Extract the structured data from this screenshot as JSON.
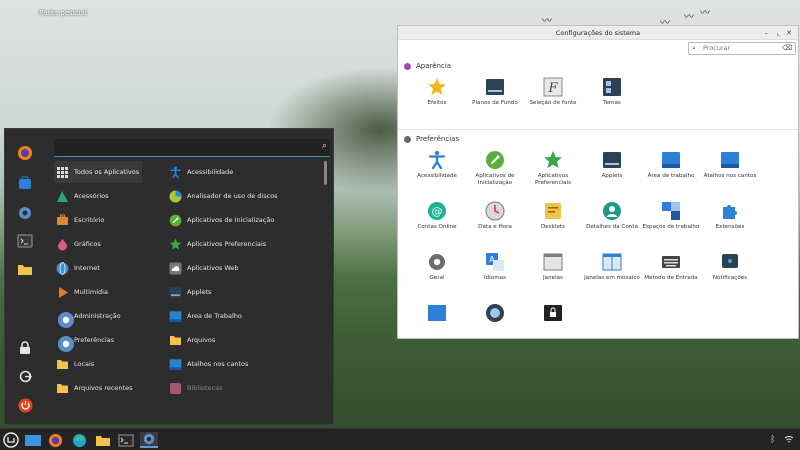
{
  "desktop": {
    "icon_label": "Pasta pessoal"
  },
  "menu": {
    "search_placeholder": "",
    "categories": [
      {
        "label": "Todos os Aplicativos",
        "icon": "grid-icon",
        "color": "#dddddd"
      },
      {
        "label": "Acessórios",
        "icon": "accessories-icon",
        "color": "#2aa876"
      },
      {
        "label": "Escritório",
        "icon": "briefcase-icon",
        "color": "#d98a3a"
      },
      {
        "label": "Gráficos",
        "icon": "graphics-icon",
        "color": "#e0578b"
      },
      {
        "label": "Internet",
        "icon": "globe-icon",
        "color": "#3b8fd9"
      },
      {
        "label": "Multimídia",
        "icon": "play-icon",
        "color": "#f0712b"
      },
      {
        "label": "Administração",
        "icon": "gear-icon",
        "color": "#5b8fc9"
      },
      {
        "label": "Preferências",
        "icon": "gear-icon",
        "color": "#5b8fc9"
      },
      {
        "label": "Locais",
        "icon": "folder-icon",
        "color": "#f2c24a"
      },
      {
        "label": "Arquivos recentes",
        "icon": "recent-folder-icon",
        "color": "#f2c24a"
      }
    ],
    "apps": [
      {
        "label": "Acessibilidade",
        "icon": "accessibility-icon",
        "color": "#2f7fd8"
      },
      {
        "label": "Analisador de uso de discos",
        "icon": "disk-usage-icon",
        "color": "#a8c93a"
      },
      {
        "label": "Aplicativos de Inicialização",
        "icon": "rocket-icon",
        "color": "#5aae3f"
      },
      {
        "label": "Aplicativos Preferenciais",
        "icon": "star-icon",
        "color": "#3aa54a"
      },
      {
        "label": "Aplicativos Web",
        "icon": "cloud-icon",
        "color": "#6c7a86"
      },
      {
        "label": "Applets",
        "icon": "applets-icon",
        "color": "#2c4152"
      },
      {
        "label": "Área de Trabalho",
        "icon": "desktop-icon",
        "color": "#2d7fd8"
      },
      {
        "label": "Arquivos",
        "icon": "folder-icon",
        "color": "#f2c24a"
      },
      {
        "label": "Atalhos nos cantos",
        "icon": "corners-icon",
        "color": "#2d7fd8"
      },
      {
        "label": "Bibliotecas",
        "icon": "library-icon",
        "color": "#a35a6a"
      }
    ]
  },
  "settings": {
    "title": "Configurações do sistema",
    "search_placeholder": "Procurar",
    "sections": [
      {
        "title": "Aparência",
        "dot_color": "#9a4ea8",
        "items": [
          {
            "label": "Efeitos",
            "icon": "star-icon",
            "color": "#f2b824"
          },
          {
            "label": "Planos de Fundo",
            "icon": "wallpaper-icon",
            "color": "#2c4152"
          },
          {
            "label": "Seleção de fonte",
            "icon": "font-icon",
            "color": "#8a8a8a"
          },
          {
            "label": "Temas",
            "icon": "themes-icon",
            "color": "#2c4152"
          }
        ]
      },
      {
        "title": "Preferências",
        "dot_color": "#666666",
        "items": [
          {
            "label": "Acessibilidade",
            "icon": "accessibility-icon",
            "color": "#2f7fd8"
          },
          {
            "label": "Aplicativos de Inicialização",
            "icon": "rocket-icon",
            "color": "#5aae3f"
          },
          {
            "label": "Aplicativos Preferenciais",
            "icon": "star-icon",
            "color": "#3aa54a"
          },
          {
            "label": "Applets",
            "icon": "applets-icon",
            "color": "#2c4152"
          },
          {
            "label": "Área de trabalho",
            "icon": "desktop-icon",
            "color": "#2d7fd8"
          },
          {
            "label": "Atalhos nos cantos",
            "icon": "corners-icon",
            "color": "#2d7fd8"
          },
          {
            "label": "Contas Online",
            "icon": "at-icon",
            "color": "#1ab394"
          },
          {
            "label": "Data e Hora",
            "icon": "clock-icon",
            "color": "#d9d9d9"
          },
          {
            "label": "Desklets",
            "icon": "desklets-icon",
            "color": "#f2c24a"
          },
          {
            "label": "Detalhes da Conta",
            "icon": "account-icon",
            "color": "#1a9b8a"
          },
          {
            "label": "Espaços de trabalho",
            "icon": "workspaces-icon",
            "color": "#2d7fd8"
          },
          {
            "label": "Extensões",
            "icon": "puzzle-icon",
            "color": "#2d7fd8"
          },
          {
            "label": "Geral",
            "icon": "gear-icon",
            "color": "#6c6c6c"
          },
          {
            "label": "Idiomas",
            "icon": "language-icon",
            "color": "#2d7fd8"
          },
          {
            "label": "Janelas",
            "icon": "windows-icon",
            "color": "#7c7c7c"
          },
          {
            "label": "Janelas em mosaico",
            "icon": "tiling-icon",
            "color": "#2d7fd8"
          },
          {
            "label": "Método de Entrada",
            "icon": "keyboard-icon",
            "color": "#444444"
          },
          {
            "label": "Notificações",
            "icon": "notification-icon",
            "color": "#2c4152"
          },
          {
            "label": "",
            "icon": "panel-icon",
            "color": "#2d7fd8"
          },
          {
            "label": "",
            "icon": "privacy-icon",
            "color": "#2c4152"
          },
          {
            "label": "",
            "icon": "lock-screen-icon",
            "color": "#222222"
          }
        ]
      }
    ]
  },
  "taskbar": {
    "items": [
      "menu-icon",
      "show-desktop-icon",
      "firefox-icon",
      "browser-icon",
      "files-icon",
      "terminal-icon",
      "settings-icon"
    ]
  }
}
